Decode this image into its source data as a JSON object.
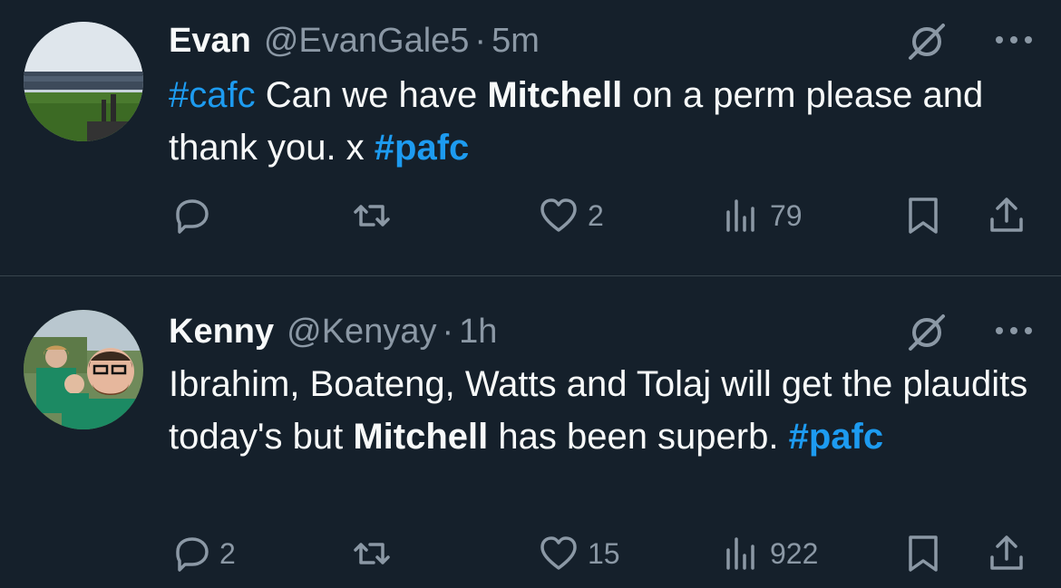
{
  "tweets": [
    {
      "name": "Evan",
      "handle": "@EvanGale5",
      "separator": "·",
      "time": "5m",
      "text_parts": [
        {
          "text": "#cafc",
          "style": "hashtag"
        },
        {
          "text": " Can we have ",
          "style": "plain"
        },
        {
          "text": "Mitchell",
          "style": "bold"
        },
        {
          "text": " on a perm please and thank you. x ",
          "style": "plain"
        },
        {
          "text": "#pafc",
          "style": "hashtag-bold"
        }
      ],
      "actions": {
        "replies": "",
        "retweets": "",
        "likes": "2",
        "views": "79"
      }
    },
    {
      "name": "Kenny",
      "handle": "@Kenyay",
      "separator": "·",
      "time": "1h",
      "text_parts": [
        {
          "text": "Ibrahim, Boateng, Watts and Tolaj will get the plaudits today's but ",
          "style": "plain"
        },
        {
          "text": "Mitchell",
          "style": "bold"
        },
        {
          "text": " has been superb. ",
          "style": "plain"
        },
        {
          "text": "#pafc",
          "style": "hashtag-bold"
        }
      ],
      "actions": {
        "replies": "2",
        "retweets": "",
        "likes": "15",
        "views": "922"
      }
    }
  ],
  "colors": {
    "background": "#15202b",
    "text": "#f7f9f9",
    "secondary": "#8b98a5",
    "hashtag": "#1d9bf0",
    "divider": "#38444d"
  },
  "icons": [
    "reply-icon",
    "retweet-icon",
    "like-icon",
    "views-icon",
    "bookmark-icon",
    "share-icon",
    "grok-icon",
    "more-icon"
  ]
}
